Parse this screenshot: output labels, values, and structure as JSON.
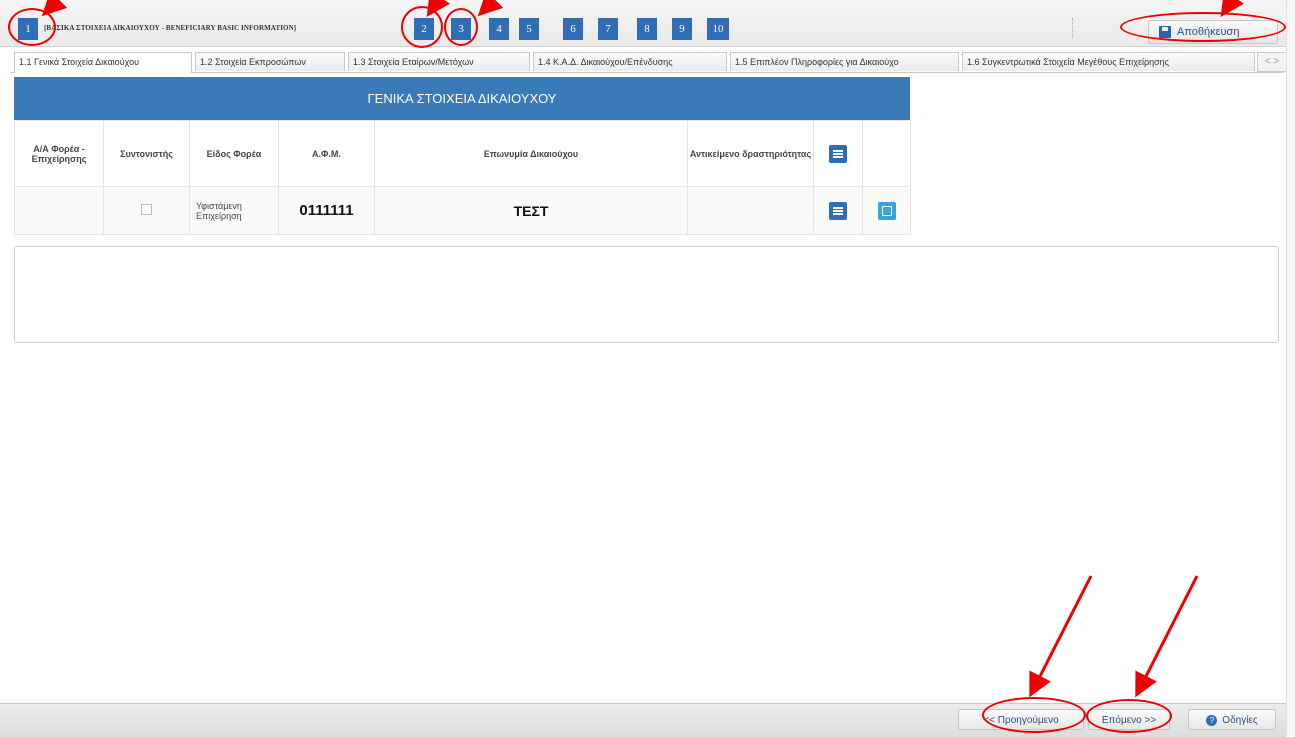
{
  "steps": {
    "step1": "1",
    "title": "[ΒΑΣΙΚΑ ΣΤΟΙΧΕΙΑ ΔΙΚΑΙΟΥΧΟΥ - BENEFICIARY BASIC INFORMATION]",
    "step2": "2",
    "step3": "3",
    "step4": "4",
    "step5": "5",
    "step6": "6",
    "step7": "7",
    "step8": "8",
    "step9": "9",
    "step10": "10"
  },
  "toolbar": {
    "save_label": "Αποθήκευση"
  },
  "tabs": {
    "t1": "1.1 Γενικά Στοιχεία Δικαιούχου",
    "t2": "1.2 Στοιχεία Εκπροσώπων",
    "t3": "1.3 Στοιχεία Εταίρων/Μετόχων",
    "t4": "1.4 Κ.Α.Δ. Δικαιούχου/Επένδυσης",
    "t5": "1.5 Επιπλέον Πληροφορίες για Δικαιούχο",
    "t6": "1.6 Συγκεντρωτικά Στοιχεία Μεγέθους Επιχείρησης",
    "arrows": "< >"
  },
  "grid": {
    "title": "ΓΕΝΙΚΑ ΣΤΟΙΧΕΙΑ ΔΙΚΑΙΟΥΧΟΥ",
    "col_aa": "Α/Α Φορέα - Επιχείρησης",
    "col_coord": "Συντονιστής",
    "col_type": "Είδος Φορέα",
    "col_afm": "Α.Φ.Μ.",
    "col_name": "Επωνυμία Δικαιούχου",
    "col_activity": "Αντικείμενο δραστηριότητας",
    "row": {
      "type": "Υφιστάμενη Επιχείρηση",
      "afm": "0111111",
      "name": "ΤΕΣΤ"
    }
  },
  "footer": {
    "prev_label": "<< Προηγούμενο",
    "next_label": "Επόμενο >>",
    "help_label": "Οδηγίες"
  },
  "colors": {
    "accent": "#2f6eb5",
    "header": "#3a7ab8",
    "annotation": "#e00000"
  }
}
